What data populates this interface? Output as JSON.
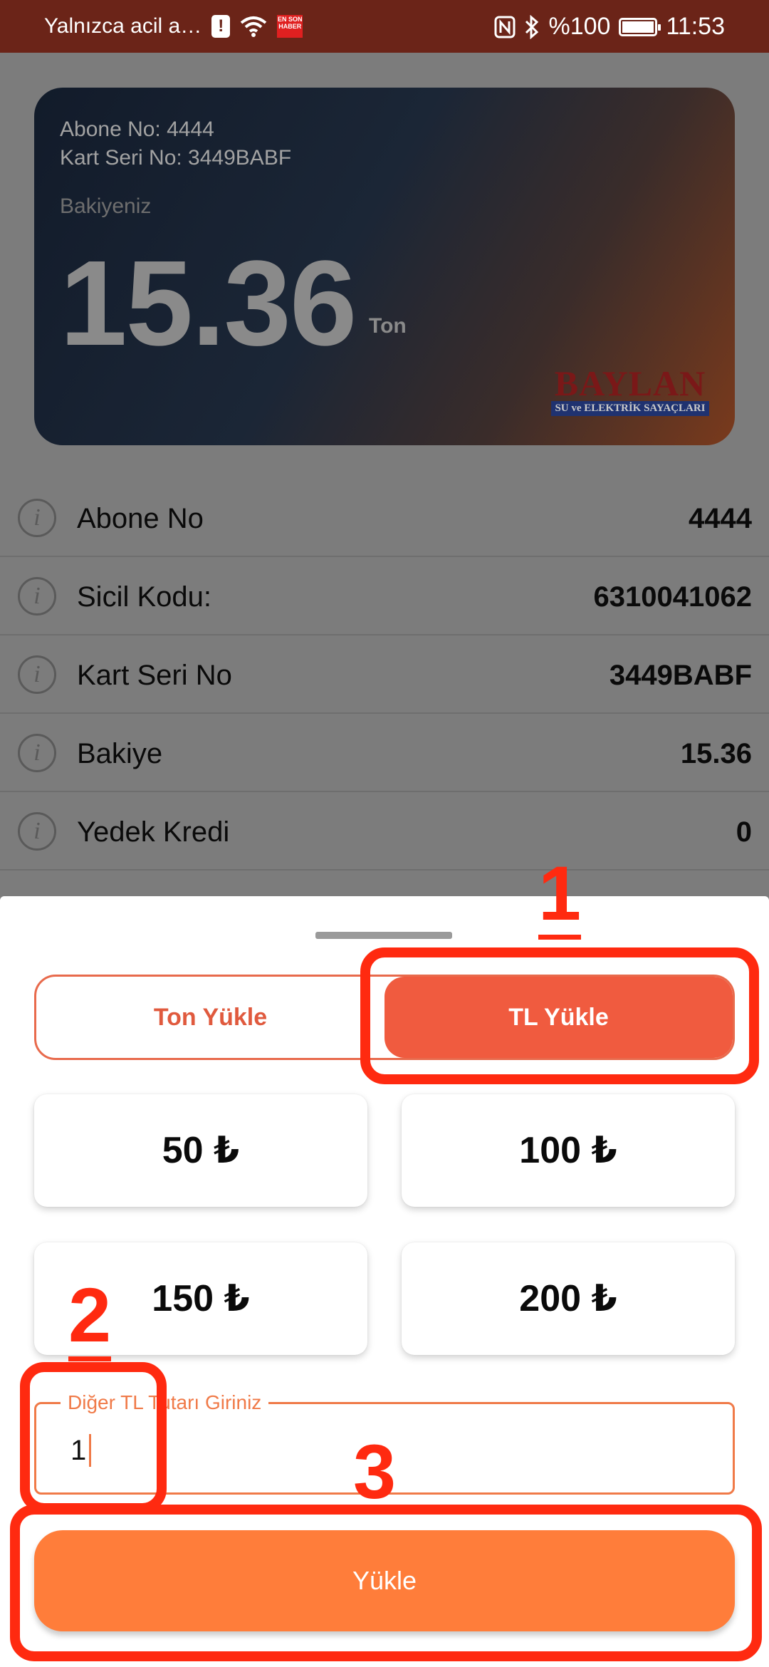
{
  "status_bar": {
    "left_text": "Yalnızca acil a…",
    "alert_glyph": "!",
    "news_badge": "EN SON HABER",
    "battery_percent": "%100",
    "time": "11:53",
    "icons": [
      "alert-icon",
      "wifi-icon",
      "news-icon",
      "nfc-icon",
      "bluetooth-icon",
      "battery-icon"
    ]
  },
  "card": {
    "subscriber_line": "Abone No: 4444",
    "card_serial_line": "Kart Seri No: 3449BABF",
    "balance_label": "Bakiyeniz",
    "balance_value": "15.36",
    "balance_unit": "Ton",
    "logo_brand": "BAYLAN",
    "logo_tagline": "SU ve ELEKTRİK SAYAÇLARI"
  },
  "info_rows": [
    {
      "label": "Abone No",
      "value": "4444"
    },
    {
      "label": "Sicil Kodu:",
      "value": "6310041062"
    },
    {
      "label": "Kart Seri No",
      "value": "3449BABF"
    },
    {
      "label": "Bakiye",
      "value": "15.36"
    },
    {
      "label": "Yedek Kredi",
      "value": "0"
    }
  ],
  "info_icon_glyph": "i",
  "sheet": {
    "tabs": [
      {
        "label": "Ton Yükle",
        "active": false
      },
      {
        "label": "TL Yükle",
        "active": true
      }
    ],
    "amounts": [
      "50 ₺",
      "100 ₺",
      "150 ₺",
      "200 ₺"
    ],
    "custom_amount": {
      "label": "Diğer TL Tutarı Giriniz",
      "value": "1"
    },
    "submit_label": "Yükle"
  },
  "annotations": [
    "1",
    "2",
    "3"
  ],
  "colors": {
    "accent": "#f05b3f",
    "submit": "#ff7d3a",
    "annotation": "#ff2a10",
    "status_bar": "#6b2418"
  }
}
